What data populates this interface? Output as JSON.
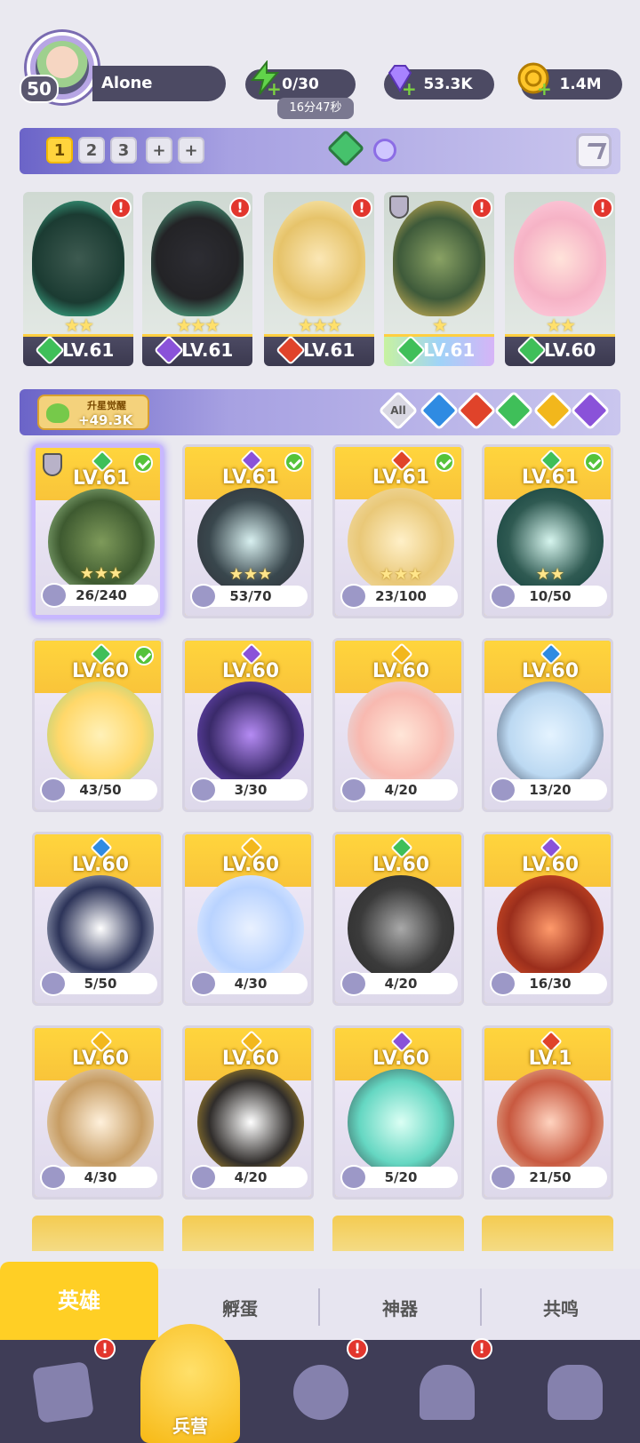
{
  "player": {
    "level": "50",
    "name": "Alone"
  },
  "resources": {
    "energy": {
      "value": "0/30",
      "timer": "16分47秒"
    },
    "gems": {
      "value": "53.3K"
    },
    "gold": {
      "value": "1.4M"
    }
  },
  "team_tabs": [
    "1",
    "2",
    "3",
    "+",
    "+"
  ],
  "team": [
    {
      "level": "LV.61",
      "element": "grass",
      "stars": "★★"
    },
    {
      "level": "LV.61",
      "element": "dark",
      "stars": "★★★"
    },
    {
      "level": "LV.61",
      "element": "fire",
      "stars": "★★★"
    },
    {
      "level": "LV.61",
      "element": "grass",
      "stars": "★"
    },
    {
      "level": "LV.60",
      "element": "grass",
      "stars": "★★"
    }
  ],
  "awaken": {
    "label": "升星觉醒",
    "value": "+49.3K"
  },
  "filters": [
    "All",
    "water",
    "fire",
    "grass",
    "light",
    "dark"
  ],
  "heroes": [
    {
      "level": "LV.61",
      "frag": "26/240",
      "element": "grass",
      "checked": true
    },
    {
      "level": "LV.61",
      "frag": "53/70",
      "element": "dark",
      "checked": true
    },
    {
      "level": "LV.61",
      "frag": "23/100",
      "element": "fire",
      "checked": true
    },
    {
      "level": "LV.61",
      "frag": "10/50",
      "element": "grass",
      "checked": true
    },
    {
      "level": "LV.60",
      "frag": "43/50",
      "element": "grass",
      "checked": true
    },
    {
      "level": "LV.60",
      "frag": "3/30",
      "element": "dark",
      "checked": false
    },
    {
      "level": "LV.60",
      "frag": "4/20",
      "element": "light",
      "checked": false
    },
    {
      "level": "LV.60",
      "frag": "13/20",
      "element": "water",
      "checked": false
    },
    {
      "level": "LV.60",
      "frag": "5/50",
      "element": "water",
      "checked": false
    },
    {
      "level": "LV.60",
      "frag": "4/30",
      "element": "light",
      "checked": false
    },
    {
      "level": "LV.60",
      "frag": "4/20",
      "element": "grass",
      "checked": false
    },
    {
      "level": "LV.60",
      "frag": "16/30",
      "element": "dark",
      "checked": false
    },
    {
      "level": "LV.60",
      "frag": "4/30",
      "element": "light",
      "checked": false
    },
    {
      "level": "LV.60",
      "frag": "4/20",
      "element": "light",
      "checked": false
    },
    {
      "level": "LV.60",
      "frag": "5/20",
      "element": "dark",
      "checked": false
    },
    {
      "level": "LV.1",
      "frag": "21/50",
      "element": "fire",
      "checked": false
    }
  ],
  "tabs": {
    "heroes": "英雄",
    "hatch": "孵蛋",
    "artifact": "神器",
    "resonance": "共鸣"
  },
  "nav": {
    "barracks": "兵营"
  },
  "colors": {
    "grass": "#3fbf59",
    "dark": "#8a52d9",
    "fire": "#e0432a",
    "water": "#2f8be2",
    "light": "#f2b71c",
    "accent": "#ffcf25"
  }
}
